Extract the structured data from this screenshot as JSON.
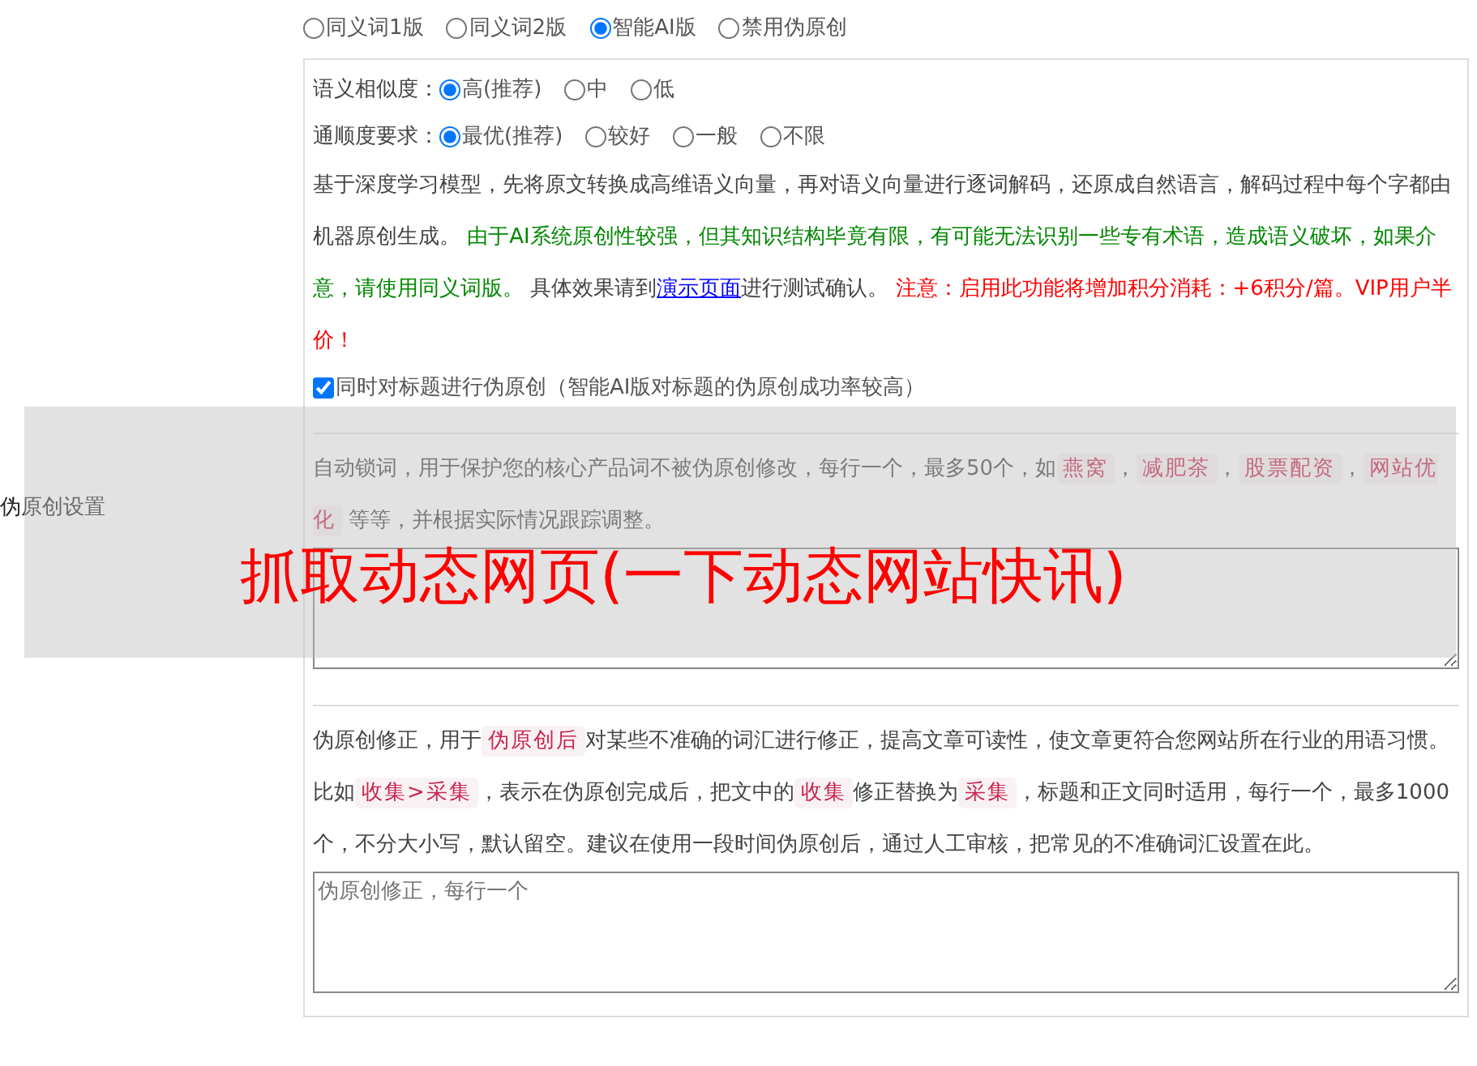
{
  "section_label": "伪原创设置",
  "modes": [
    {
      "label": "同义词1版",
      "selected": false
    },
    {
      "label": "同义词2版",
      "selected": false
    },
    {
      "label": "智能AI版",
      "selected": true
    },
    {
      "label": "禁用伪原创",
      "selected": false
    }
  ],
  "similarity": {
    "label": "语义相似度：",
    "options": [
      {
        "label": "高(推荐)",
        "selected": true
      },
      {
        "label": "中",
        "selected": false
      },
      {
        "label": "低",
        "selected": false
      }
    ]
  },
  "fluency": {
    "label": "通顺度要求：",
    "options": [
      {
        "label": "最优(推荐)",
        "selected": true
      },
      {
        "label": "较好",
        "selected": false
      },
      {
        "label": "一般",
        "selected": false
      },
      {
        "label": "不限",
        "selected": false
      }
    ]
  },
  "ai_description": [
    {
      "kind": "plain",
      "text": "基于深度学习模型，先将原文转换成高维语义向量，再对语义向量进行逐词解码，还原成自然语言，解码过程中每个字都由机器原创生成。 "
    },
    {
      "kind": "green",
      "text": "由于AI系统原创性较强，但其知识结构毕竟有限，有可能无法识别一些专有术语，造成语义破坏，如果介意，请使用同义词版。"
    },
    {
      "kind": "plain",
      "text": " 具体效果请到"
    },
    {
      "kind": "link",
      "text": "演示页面"
    },
    {
      "kind": "plain",
      "text": "进行测试确认。 "
    },
    {
      "kind": "red",
      "text": "注意：启用此功能将增加积分消耗：+6积分/篇。VIP用户半价！"
    }
  ],
  "title_option": {
    "label": "同时对标题进行伪原创（智能AI版对标题的伪原创成功率较高）",
    "checked": true
  },
  "lock_description": [
    {
      "kind": "plain",
      "text": "自动锁词，用于保护您的核心产品词不被伪原创修改，每行一个，最多50个，如"
    },
    {
      "kind": "code",
      "text": "燕窝"
    },
    {
      "kind": "plain",
      "text": "，"
    },
    {
      "kind": "code",
      "text": "减肥茶"
    },
    {
      "kind": "plain",
      "text": "，"
    },
    {
      "kind": "code",
      "text": "股票配资"
    },
    {
      "kind": "plain",
      "text": "，"
    },
    {
      "kind": "code",
      "text": "网站优化"
    },
    {
      "kind": "plain",
      "text": " 等等，并根据实际情况跟踪调整。"
    }
  ],
  "correction_description": [
    {
      "kind": "plain",
      "text": "伪原创修正，用于"
    },
    {
      "kind": "code",
      "text": "伪原创后"
    },
    {
      "kind": "plain",
      "text": "对某些不准确的词汇进行修正，提高文章可读性，使文章更符合您网站所在行业的用语习惯。比如"
    },
    {
      "kind": "code",
      "text": "收集>采集"
    },
    {
      "kind": "plain",
      "text": "，表示在伪原创完成后，把文中的"
    },
    {
      "kind": "code",
      "text": "收集"
    },
    {
      "kind": "plain",
      "text": "修正替换为"
    },
    {
      "kind": "code",
      "text": "采集"
    },
    {
      "kind": "plain",
      "text": "，标题和正文同时适用，每行一个，最多1000个，不分大小写，默认留空。建议在使用一段时间伪原创后，通过人工审核，把常见的不准确词汇设置在此。"
    }
  ],
  "correction_field": {
    "placeholder": "伪原创修正，每行一个"
  },
  "overlay_title": "抓取动态网页(一下动态网站快讯)"
}
